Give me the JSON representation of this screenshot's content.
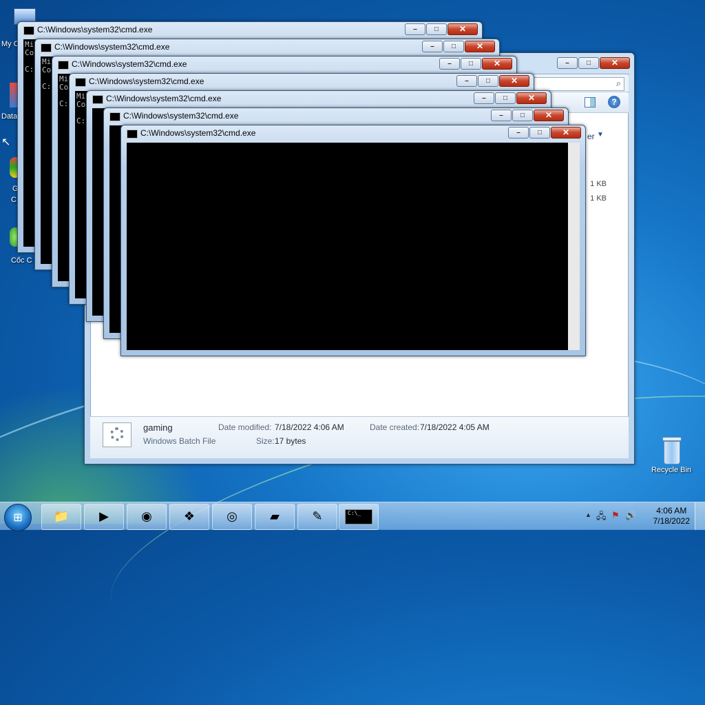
{
  "desktop": {
    "icons_left": [
      {
        "label": "My C"
      },
      {
        "label": "Data"
      },
      {
        "label": "G"
      },
      {
        "label": "C"
      },
      {
        "label": "Cốc C"
      }
    ],
    "recycle_bin": {
      "label": "Recycle Bin"
    }
  },
  "explorer": {
    "column_fragment": "er",
    "sizes": [
      "1 KB",
      "1 KB"
    ],
    "details": {
      "file_name": "gaming",
      "file_type": "Windows Batch File",
      "date_modified_label": "Date modified:",
      "date_modified": "7/18/2022 4:06 AM",
      "date_created_label": "Date created:",
      "date_created": "7/18/2022 4:05 AM",
      "size_label": "Size:",
      "size": "17 bytes"
    }
  },
  "cmd_windows": [
    {
      "title": "C:\\Windows\\system32\\cmd.exe",
      "lines": [
        "Mi",
        "Co",
        "",
        "C:"
      ]
    },
    {
      "title": "C:\\Windows\\system32\\cmd.exe",
      "lines": [
        "Mi",
        "Co",
        "",
        "C:"
      ]
    },
    {
      "title": "C:\\Windows\\system32\\cmd.exe",
      "lines": [
        "Mi",
        "Co",
        "",
        "C:"
      ]
    },
    {
      "title": "C:\\Windows\\system32\\cmd.exe",
      "lines": [
        "Mi",
        "Co",
        "",
        "C:"
      ]
    },
    {
      "title": "C:\\Windows\\system32\\cmd.exe",
      "lines": [
        "",
        "",
        "",
        ""
      ]
    },
    {
      "title": "C:\\Windows\\system32\\cmd.exe",
      "lines": [
        "",
        "",
        "",
        ""
      ]
    },
    {
      "title": "C:\\Windows\\system32\\cmd.exe",
      "lines": [
        "",
        "",
        "",
        ""
      ]
    }
  ],
  "window_buttons": {
    "minimize": "–",
    "maximize": "□",
    "close": "✕"
  },
  "taskbar": {
    "start_glyph": "⊞",
    "pinned": [
      {
        "name": "explorer-taskbar-button",
        "icon": "folder-icon",
        "glyph": "📁"
      },
      {
        "name": "media-player-taskbar-button",
        "icon": "media-player-icon",
        "glyph": "▶"
      },
      {
        "name": "chrome-taskbar-button",
        "icon": "chrome-icon",
        "glyph": "◉"
      },
      {
        "name": "windows-taskbar-button",
        "icon": "windows-logo-icon",
        "glyph": "❖"
      },
      {
        "name": "coccoc-taskbar-button",
        "icon": "coccoc-icon",
        "glyph": "◎"
      },
      {
        "name": "notes-taskbar-button",
        "icon": "sticky-notes-icon",
        "glyph": "▰"
      },
      {
        "name": "notepad-taskbar-button",
        "icon": "notepad-icon",
        "glyph": "✎"
      },
      {
        "name": "cmd-taskbar-button",
        "icon": "cmd-icon",
        "glyph": "C:\\_"
      }
    ],
    "tray_glyphs": [
      "▲",
      "🖧",
      "⚑",
      "🔊"
    ],
    "time": "4:06 AM",
    "date": "7/18/2022"
  }
}
